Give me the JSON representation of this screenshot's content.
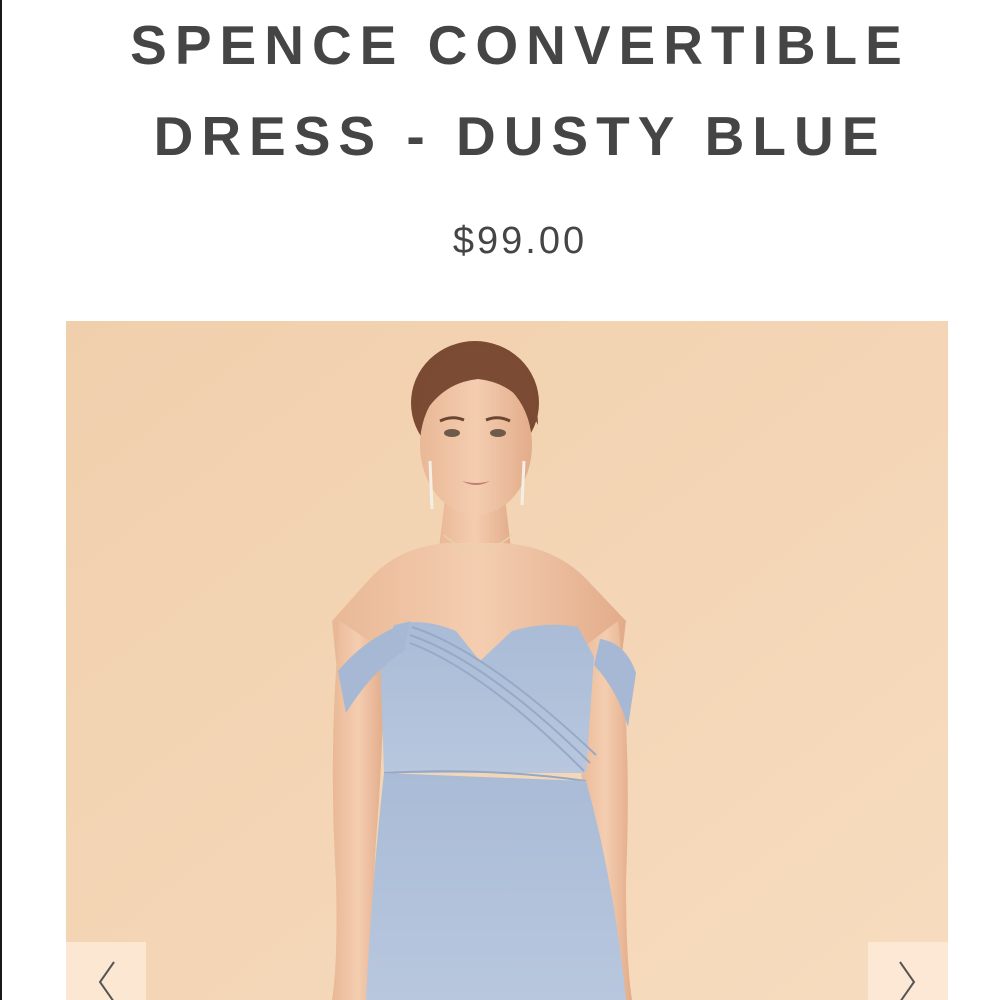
{
  "product": {
    "title": "SPENCE CONVERTIBLE DRESS - DUSTY BLUE",
    "price": "$99.00"
  },
  "gallery": {
    "prev_icon": "chevron-left-icon",
    "next_icon": "chevron-right-icon"
  },
  "colors": {
    "text": "#454545",
    "photo_background": "#f3d4b2",
    "dress": "#aebfd8",
    "nav_button": "#fdebdc"
  }
}
